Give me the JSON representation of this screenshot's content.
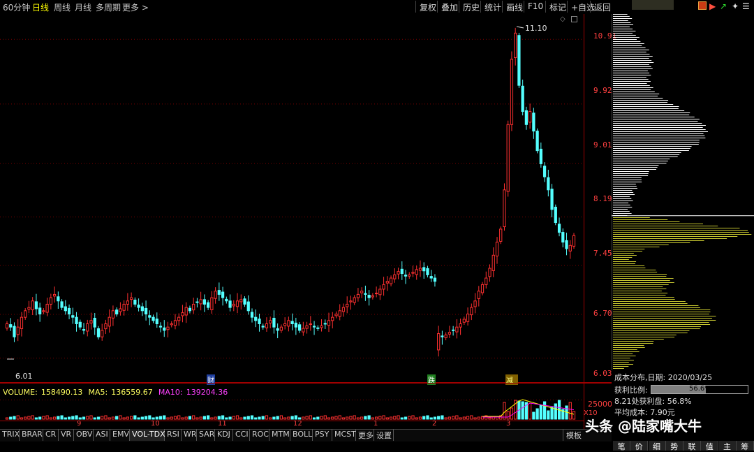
{
  "toolbar": {
    "periods": [
      "60分钟",
      "日线",
      "周线",
      "月线",
      "多周期",
      "更多 >"
    ],
    "active_period": "日线",
    "buttons": [
      "复权",
      "叠加",
      "历史",
      "统计",
      "画线",
      "F10",
      "标记",
      "+自选",
      "返回"
    ]
  },
  "chart_data": {
    "type": "candlestick",
    "y_axis_ticks": [
      "10.91",
      "9.92",
      "9.01",
      "8.19",
      "7.45",
      "6.70",
      "6.03"
    ],
    "high_marker": "11.10",
    "low_marker": "6.01",
    "event_tags": [
      "财",
      "跌",
      "减"
    ],
    "colors": {
      "up": "#ff3030",
      "down": "#54ffff",
      "grid": "#7a0000",
      "axis": "#a00000"
    }
  },
  "volume": {
    "label": "VOLUME:",
    "value": "158490.13",
    "ma5_label": "MA5:",
    "ma5_value": "136559.67",
    "ma10_label": "MA10:",
    "ma10_value": "139204.36",
    "axis_value": "25000",
    "axis_unit": "X10",
    "colors": {
      "volume": "#ffffff",
      "ma5": "#ffff00",
      "ma10": "#ff00ff"
    }
  },
  "date_axis": [
    "9",
    "10",
    "11",
    "12",
    "1",
    "2",
    "3"
  ],
  "indicators": [
    "TRIX",
    "BRAR",
    "CR",
    "VR",
    "OBV",
    "ASI",
    "EMV",
    "VOL-TDX",
    "RSI",
    "WR",
    "SAR",
    "KDJ",
    "CCI",
    "ROC",
    "MTM",
    "BOLL",
    "PSY",
    "MCST",
    "更多",
    "设置"
  ],
  "active_indicator": "VOL-TDX",
  "template_label": "模板",
  "cost_panel": {
    "title": "成本分布,日期: 2020/03/25",
    "profit_label": "获利比例:",
    "profit_value": "56.6%",
    "profit_ratio": 0.566,
    "line2": "8.21处获利盘: 56.8%",
    "line3": "平均成本: 7.90元",
    "colors": {
      "profit": "#c8c830",
      "loss": "#ffffff"
    }
  },
  "bottom_tabs": [
    "笔",
    "价",
    "细",
    "势",
    "联",
    "值",
    "主",
    "筹"
  ],
  "watermark": "头条 @陆家嘴大牛"
}
